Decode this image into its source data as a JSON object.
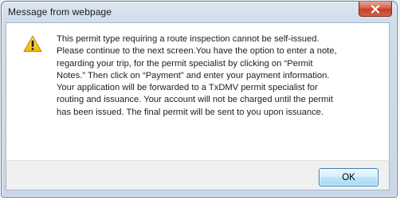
{
  "window": {
    "title": "Message from webpage",
    "close_icon": "close-icon"
  },
  "dialog": {
    "icon": "warning-icon",
    "message": "This permit type requiring a route inspection cannot be self-issued.\nPlease continue to the next screen.You have the option to enter a note,\nregarding your trip, for the permit specialist by clicking on “Permit\nNotes.” Then click on “Payment” and enter your payment information.\nYour application will be forwarded to a TxDMV permit specialist for\nrouting and issuance. Your account will not be charged until the permit\nhas been issued. The final permit will be sent to you upon issuance.",
    "ok_label": "OK"
  },
  "colors": {
    "warning_fill": "#f7c31a",
    "close_red": "#c4412b",
    "ok_border": "#3c7fb1"
  }
}
